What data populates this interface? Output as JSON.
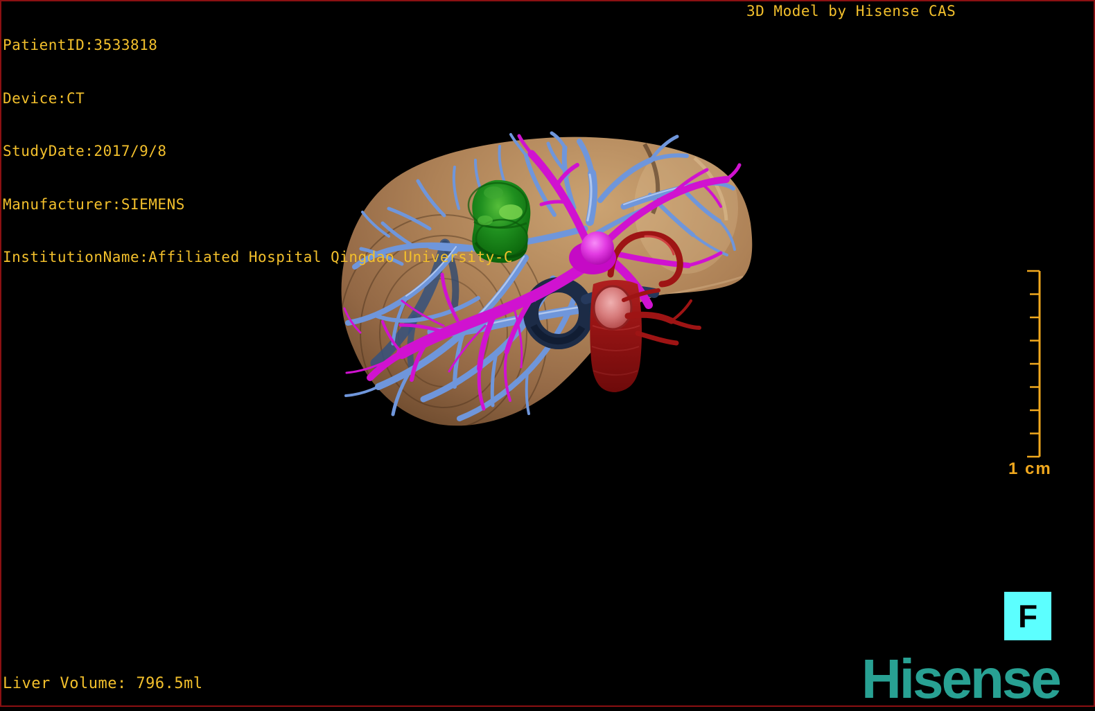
{
  "header": {
    "patient_info": [
      "PatientID:3533818",
      "Device:CT",
      "StudyDate:2017/9/8",
      "Manufacturer:SIEMENS",
      "InstitutionName:Affiliated Hospital Qingdao University-C"
    ],
    "watermark": "3D Model by Hisense CAS"
  },
  "footer": {
    "liver_volume": "Liver Volume: 796.5ml",
    "brand": "Hisense"
  },
  "viewport": {
    "orientation_label": "F",
    "ruler": {
      "label": "1 cm",
      "tick_count": 9
    }
  },
  "colors": {
    "background": "#000000",
    "frame_border": "#8B1012",
    "annotation_text": "#F3C02C",
    "ruler": "#F0A81E",
    "liver_surface": "#A87E52",
    "hepatic_vein": "#6F96DB",
    "hepatic_vein_highlight": "#BCD0F2",
    "portal_vein": "#D012D0",
    "hepatic_artery": "#9E1414",
    "tumor": "#168016",
    "stent_ring": "#1C2B46",
    "orientation_bg": "#5CFFFF",
    "orientation_fg": "#000000",
    "brand": "#28A193"
  }
}
